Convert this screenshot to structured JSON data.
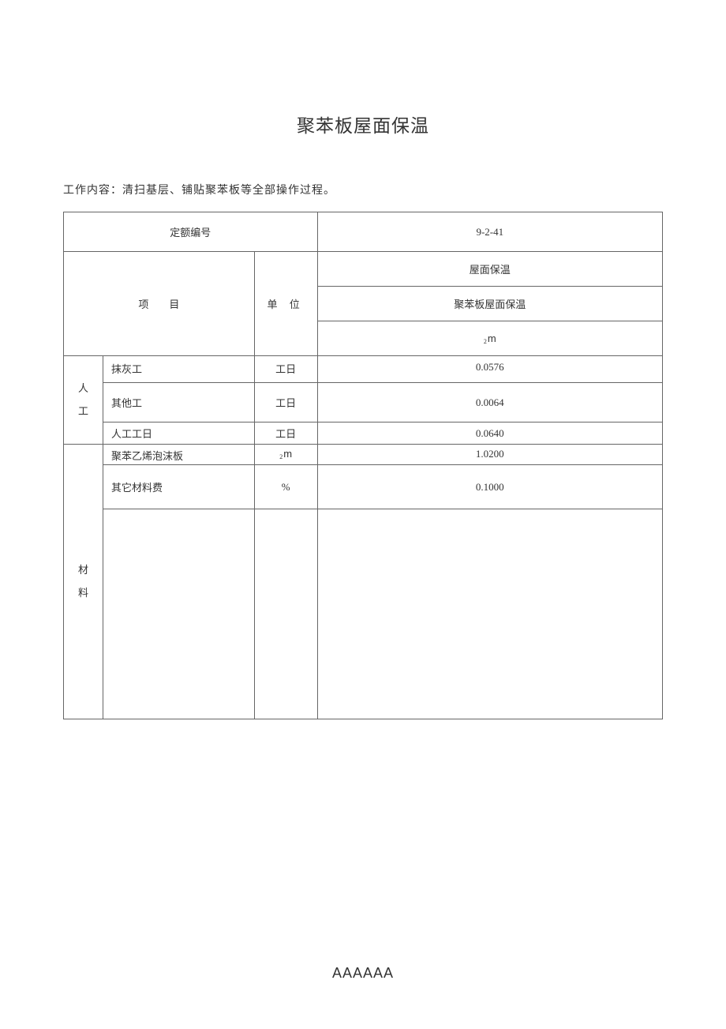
{
  "title": "聚苯板屋面保温",
  "work_desc": "工作内容：清扫基层、铺贴聚苯板等全部操作过程。",
  "header": {
    "quota_no_label": "定额编号",
    "quota_no_value": "9-2-41",
    "project_label": "项　　目",
    "unit_label": "单 位",
    "category": "屋面保温",
    "subcategory": "聚苯板屋面保温",
    "measure_unit_prefix": "2",
    "measure_unit_suffix": "m"
  },
  "sections": {
    "labor": "人工",
    "material": "材料"
  },
  "rows": [
    {
      "name": "抹灰工",
      "unit": "工日",
      "value": "0.0576"
    },
    {
      "name": "其他工",
      "unit": "工日",
      "value": "0.0064"
    },
    {
      "name": "人工工日",
      "unit": "工日",
      "value": "0.0640"
    },
    {
      "name": "聚苯乙烯泡沫板",
      "unit_prefix": "2",
      "unit_suffix": "m",
      "value": "1.0200"
    },
    {
      "name": "其它材料费",
      "unit": "%",
      "value": "0.1000"
    }
  ],
  "footer": "AAAAAA"
}
